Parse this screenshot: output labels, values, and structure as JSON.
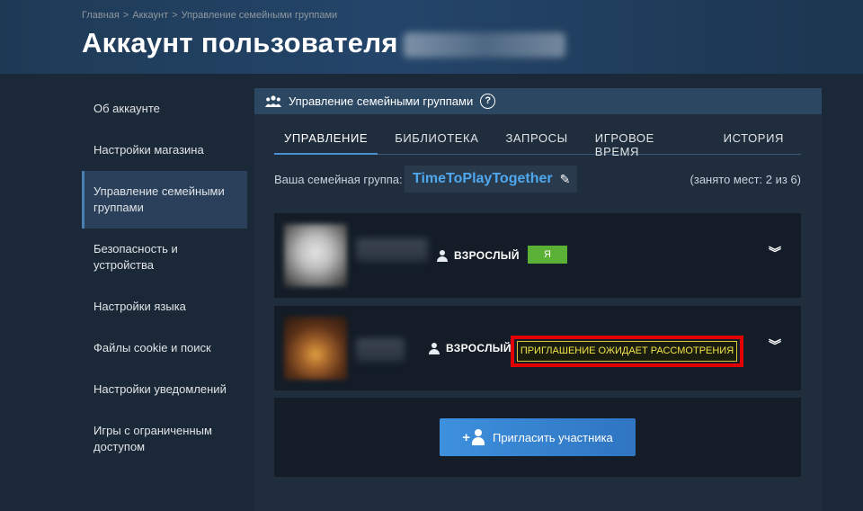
{
  "breadcrumb": {
    "items": [
      "Главная",
      "Аккаунт",
      "Управление семейными группами"
    ],
    "separator": ">"
  },
  "page": {
    "title": "Аккаунт пользователя"
  },
  "sidebar": {
    "items": [
      {
        "label": "Об аккаунте",
        "active": false
      },
      {
        "label": "Настройки магазина",
        "active": false
      },
      {
        "label": "Управление семейными группами",
        "active": true
      },
      {
        "label": "Безопасность и устройства",
        "active": false
      },
      {
        "label": "Настройки языка",
        "active": false
      },
      {
        "label": "Файлы cookie и поиск",
        "active": false
      },
      {
        "label": "Настройки уведомлений",
        "active": false
      },
      {
        "label": "Игры с ограниченным доступом",
        "active": false
      }
    ]
  },
  "panel": {
    "title": "Управление семейными группами",
    "help_glyph": "?",
    "icon": "family-group-icon"
  },
  "tabs": [
    {
      "label": "УПРАВЛЕНИЕ",
      "active": true
    },
    {
      "label": "БИБЛИОТЕКА",
      "active": false
    },
    {
      "label": "ЗАПРОСЫ",
      "active": false
    },
    {
      "label": "ИГРОВОЕ ВРЕМЯ",
      "active": false
    },
    {
      "label": "ИСТОРИЯ",
      "active": false
    }
  ],
  "group": {
    "label": "Ваша семейная группа:",
    "name": "TimeToPlayTogether",
    "edit_icon": "pencil-icon",
    "slots": "(занято мест: 2 из 6)"
  },
  "members": [
    {
      "role": "ВЗРОСЛЫЙ",
      "badge": "Я",
      "badge_color": "#5ab136"
    },
    {
      "role": "ВЗРОСЛЫЙ",
      "badge": "ПРИГЛАШЕНИЕ ОЖИДАЕТ РАССМОТРЕНИЯ",
      "badge_color": "#f2e34a",
      "highlight_color": "#e00000"
    }
  ],
  "expand_glyph": "︾",
  "invite": {
    "label": "Пригласить участника",
    "plus": "+"
  },
  "colors": {
    "background": "#1b2838",
    "accent": "#4a8fd1",
    "group_name": "#4fa8ee"
  }
}
